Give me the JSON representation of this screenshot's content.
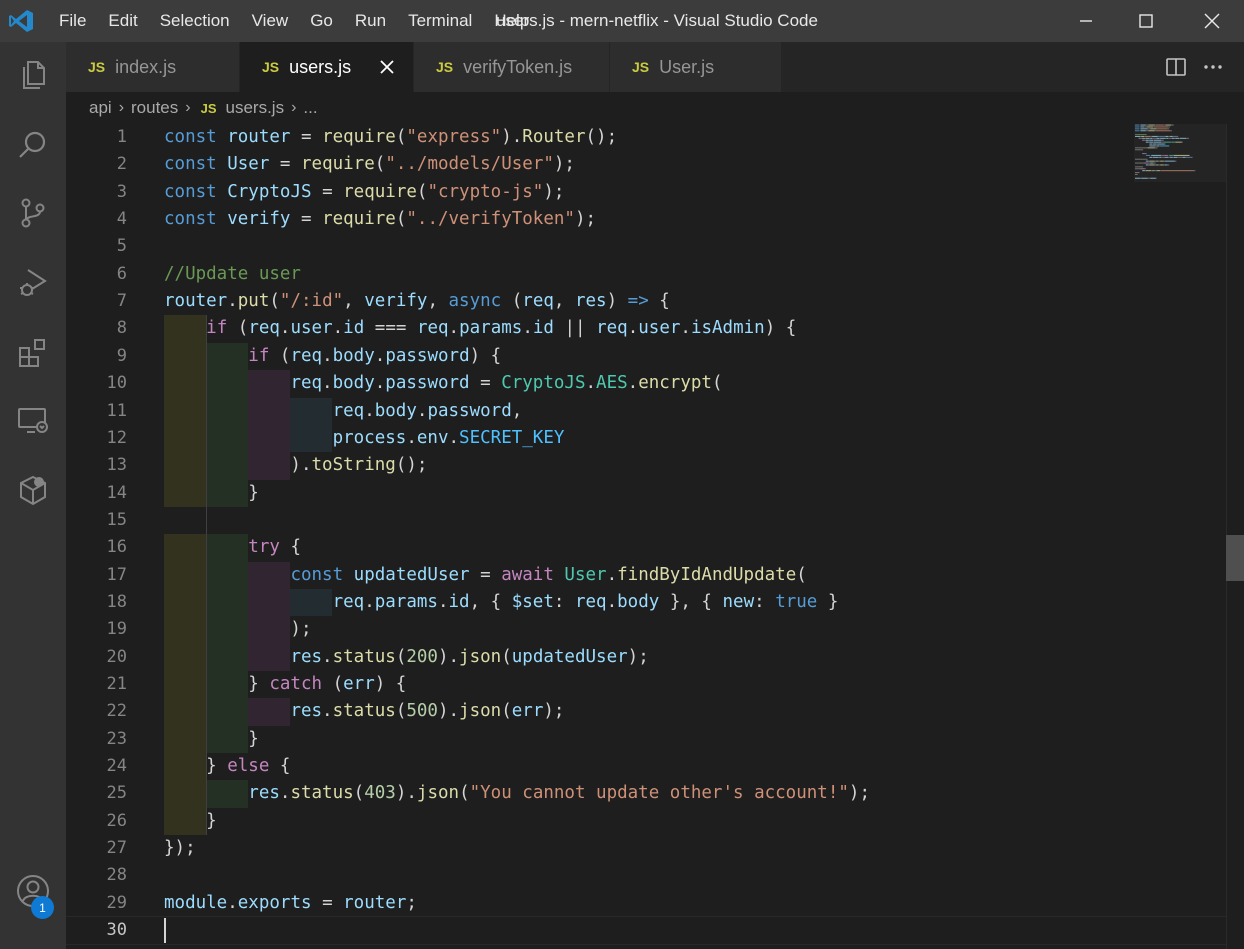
{
  "window": {
    "title": "users.js - mern-netflix - Visual Studio Code",
    "menu": [
      "File",
      "Edit",
      "Selection",
      "View",
      "Go",
      "Run",
      "Terminal",
      "Help"
    ]
  },
  "colors": {
    "titlebar": "#3c3c3c",
    "activitybar": "#333333",
    "editor_bg": "#1e1e1e",
    "keyword": "#569cd6",
    "control": "#c586c0",
    "variable": "#9cdcfe",
    "function": "#dcdcaa",
    "string": "#ce9178",
    "number": "#b5cea8",
    "comment": "#6a9955",
    "accent_badge": "#0e7ad3"
  },
  "activity_bar": {
    "icons": [
      "explorer-icon",
      "search-icon",
      "source-control-icon",
      "run-debug-icon",
      "extensions-icon",
      "remote-explorer-icon",
      "docker-icon"
    ],
    "accounts_badge": "1"
  },
  "tabs": [
    {
      "label": "index.js",
      "badge": "JS",
      "active": false
    },
    {
      "label": "users.js",
      "badge": "JS",
      "active": true
    },
    {
      "label": "verifyToken.js",
      "badge": "JS",
      "active": false
    },
    {
      "label": "User.js",
      "badge": "JS",
      "active": false
    }
  ],
  "breadcrumb": {
    "segments": [
      "api",
      "routes"
    ],
    "file_badge": "JS",
    "file": "users.js",
    "tail": "..."
  },
  "editor": {
    "current_line": 30,
    "lines": [
      {
        "n": "1"
      },
      {
        "n": "2"
      },
      {
        "n": "3"
      },
      {
        "n": "4"
      },
      {
        "n": "5"
      },
      {
        "n": "6"
      },
      {
        "n": "7"
      },
      {
        "n": "8"
      },
      {
        "n": "9"
      },
      {
        "n": "10"
      },
      {
        "n": "11"
      },
      {
        "n": "12"
      },
      {
        "n": "13"
      },
      {
        "n": "14"
      },
      {
        "n": "15"
      },
      {
        "n": "16"
      },
      {
        "n": "17"
      },
      {
        "n": "18"
      },
      {
        "n": "19"
      },
      {
        "n": "20"
      },
      {
        "n": "21"
      },
      {
        "n": "22"
      },
      {
        "n": "23"
      },
      {
        "n": "24"
      },
      {
        "n": "25"
      },
      {
        "n": "26"
      },
      {
        "n": "27"
      },
      {
        "n": "28"
      },
      {
        "n": "29"
      },
      {
        "n": "30"
      }
    ],
    "code": {
      "l1": [
        [
          "kw",
          "const"
        ],
        [
          "pl",
          " "
        ],
        [
          "var",
          "router"
        ],
        [
          "pl",
          " = "
        ],
        [
          "fn",
          "require"
        ],
        [
          "pl",
          "("
        ],
        [
          "str",
          "\"express\""
        ],
        [
          "pl",
          ")."
        ],
        [
          "fn",
          "Router"
        ],
        [
          "pl",
          "();"
        ]
      ],
      "l2": [
        [
          "kw",
          "const"
        ],
        [
          "pl",
          " "
        ],
        [
          "var",
          "User"
        ],
        [
          "pl",
          " = "
        ],
        [
          "fn",
          "require"
        ],
        [
          "pl",
          "("
        ],
        [
          "str",
          "\"../models/User\""
        ],
        [
          "pl",
          ");"
        ]
      ],
      "l3": [
        [
          "kw",
          "const"
        ],
        [
          "pl",
          " "
        ],
        [
          "var",
          "CryptoJS"
        ],
        [
          "pl",
          " = "
        ],
        [
          "fn",
          "require"
        ],
        [
          "pl",
          "("
        ],
        [
          "str",
          "\"crypto-js\""
        ],
        [
          "pl",
          ");"
        ]
      ],
      "l4": [
        [
          "kw",
          "const"
        ],
        [
          "pl",
          " "
        ],
        [
          "var",
          "verify"
        ],
        [
          "pl",
          " = "
        ],
        [
          "fn",
          "require"
        ],
        [
          "pl",
          "("
        ],
        [
          "str",
          "\"../verifyToken\""
        ],
        [
          "pl",
          ");"
        ]
      ],
      "l5": [],
      "l6": [
        [
          "com",
          "//Update user"
        ]
      ],
      "l7": [
        [
          "var",
          "router"
        ],
        [
          "pl",
          "."
        ],
        [
          "fn",
          "put"
        ],
        [
          "pl",
          "("
        ],
        [
          "str",
          "\"/:id\""
        ],
        [
          "pl",
          ", "
        ],
        [
          "var",
          "verify"
        ],
        [
          "pl",
          ", "
        ],
        [
          "kw",
          "async"
        ],
        [
          "pl",
          " ("
        ],
        [
          "var",
          "req"
        ],
        [
          "pl",
          ", "
        ],
        [
          "var",
          "res"
        ],
        [
          "pl",
          ") "
        ],
        [
          "kw",
          "=>"
        ],
        [
          "pl",
          " {"
        ]
      ],
      "l8": [
        [
          "pl",
          "    "
        ],
        [
          "ctrl",
          "if"
        ],
        [
          "pl",
          " ("
        ],
        [
          "var",
          "req"
        ],
        [
          "pl",
          "."
        ],
        [
          "var",
          "user"
        ],
        [
          "pl",
          "."
        ],
        [
          "var",
          "id"
        ],
        [
          "pl",
          " === "
        ],
        [
          "var",
          "req"
        ],
        [
          "pl",
          "."
        ],
        [
          "var",
          "params"
        ],
        [
          "pl",
          "."
        ],
        [
          "var",
          "id"
        ],
        [
          "pl",
          " || "
        ],
        [
          "var",
          "req"
        ],
        [
          "pl",
          "."
        ],
        [
          "var",
          "user"
        ],
        [
          "pl",
          "."
        ],
        [
          "var",
          "isAdmin"
        ],
        [
          "pl",
          ") {"
        ]
      ],
      "l9": [
        [
          "pl",
          "        "
        ],
        [
          "ctrl",
          "if"
        ],
        [
          "pl",
          " ("
        ],
        [
          "var",
          "req"
        ],
        [
          "pl",
          "."
        ],
        [
          "var",
          "body"
        ],
        [
          "pl",
          "."
        ],
        [
          "var",
          "password"
        ],
        [
          "pl",
          ") {"
        ]
      ],
      "l10": [
        [
          "pl",
          "            "
        ],
        [
          "var",
          "req"
        ],
        [
          "pl",
          "."
        ],
        [
          "var",
          "body"
        ],
        [
          "pl",
          "."
        ],
        [
          "var",
          "password"
        ],
        [
          "pl",
          " = "
        ],
        [
          "cls",
          "CryptoJS"
        ],
        [
          "pl",
          "."
        ],
        [
          "cls",
          "AES"
        ],
        [
          "pl",
          "."
        ],
        [
          "fn",
          "encrypt"
        ],
        [
          "pl",
          "("
        ]
      ],
      "l11": [
        [
          "pl",
          "                "
        ],
        [
          "var",
          "req"
        ],
        [
          "pl",
          "."
        ],
        [
          "var",
          "body"
        ],
        [
          "pl",
          "."
        ],
        [
          "var",
          "password"
        ],
        [
          "pl",
          ","
        ]
      ],
      "l12": [
        [
          "pl",
          "                "
        ],
        [
          "var",
          "process"
        ],
        [
          "pl",
          "."
        ],
        [
          "var",
          "env"
        ],
        [
          "pl",
          "."
        ],
        [
          "cst",
          "SECRET_KEY"
        ]
      ],
      "l13": [
        [
          "pl",
          "            )."
        ],
        [
          "fn",
          "toString"
        ],
        [
          "pl",
          "();"
        ]
      ],
      "l14": [
        [
          "pl",
          "        }"
        ]
      ],
      "l15": [],
      "l16": [
        [
          "pl",
          "        "
        ],
        [
          "ctrl",
          "try"
        ],
        [
          "pl",
          " {"
        ]
      ],
      "l17": [
        [
          "pl",
          "            "
        ],
        [
          "kw",
          "const"
        ],
        [
          "pl",
          " "
        ],
        [
          "var",
          "updatedUser"
        ],
        [
          "pl",
          " = "
        ],
        [
          "ctrl",
          "await"
        ],
        [
          "pl",
          " "
        ],
        [
          "cls",
          "User"
        ],
        [
          "pl",
          "."
        ],
        [
          "fn",
          "findByIdAndUpdate"
        ],
        [
          "pl",
          "("
        ]
      ],
      "l18": [
        [
          "pl",
          "                "
        ],
        [
          "var",
          "req"
        ],
        [
          "pl",
          "."
        ],
        [
          "var",
          "params"
        ],
        [
          "pl",
          "."
        ],
        [
          "var",
          "id"
        ],
        [
          "pl",
          ", { "
        ],
        [
          "var",
          "$set"
        ],
        [
          "pl",
          ": "
        ],
        [
          "var",
          "req"
        ],
        [
          "pl",
          "."
        ],
        [
          "var",
          "body"
        ],
        [
          "pl",
          " }, { "
        ],
        [
          "var",
          "new"
        ],
        [
          "pl",
          ": "
        ],
        [
          "kw",
          "true"
        ],
        [
          "pl",
          " }"
        ]
      ],
      "l19": [
        [
          "pl",
          "            );"
        ]
      ],
      "l20": [
        [
          "pl",
          "            "
        ],
        [
          "var",
          "res"
        ],
        [
          "pl",
          "."
        ],
        [
          "fn",
          "status"
        ],
        [
          "pl",
          "("
        ],
        [
          "num",
          "200"
        ],
        [
          "pl",
          ")."
        ],
        [
          "fn",
          "json"
        ],
        [
          "pl",
          "("
        ],
        [
          "var",
          "updatedUser"
        ],
        [
          "pl",
          ");"
        ]
      ],
      "l21": [
        [
          "pl",
          "        } "
        ],
        [
          "ctrl",
          "catch"
        ],
        [
          "pl",
          " ("
        ],
        [
          "var",
          "err"
        ],
        [
          "pl",
          ") {"
        ]
      ],
      "l22": [
        [
          "pl",
          "            "
        ],
        [
          "var",
          "res"
        ],
        [
          "pl",
          "."
        ],
        [
          "fn",
          "status"
        ],
        [
          "pl",
          "("
        ],
        [
          "num",
          "500"
        ],
        [
          "pl",
          ")."
        ],
        [
          "fn",
          "json"
        ],
        [
          "pl",
          "("
        ],
        [
          "var",
          "err"
        ],
        [
          "pl",
          ");"
        ]
      ],
      "l23": [
        [
          "pl",
          "        }"
        ]
      ],
      "l24": [
        [
          "pl",
          "    } "
        ],
        [
          "ctrl",
          "else"
        ],
        [
          "pl",
          " {"
        ]
      ],
      "l25": [
        [
          "pl",
          "        "
        ],
        [
          "var",
          "res"
        ],
        [
          "pl",
          "."
        ],
        [
          "fn",
          "status"
        ],
        [
          "pl",
          "("
        ],
        [
          "num",
          "403"
        ],
        [
          "pl",
          ")."
        ],
        [
          "fn",
          "json"
        ],
        [
          "pl",
          "("
        ],
        [
          "str",
          "\"You cannot update other's account!\""
        ],
        [
          "pl",
          ");"
        ]
      ],
      "l26": [
        [
          "pl",
          "    }"
        ]
      ],
      "l27": [
        [
          "pl",
          "});"
        ]
      ],
      "l28": [],
      "l29": [
        [
          "var",
          "module"
        ],
        [
          "pl",
          "."
        ],
        [
          "var",
          "exports"
        ],
        [
          "pl",
          " = "
        ],
        [
          "var",
          "router"
        ],
        [
          "pl",
          ";"
        ]
      ],
      "l30": []
    }
  }
}
